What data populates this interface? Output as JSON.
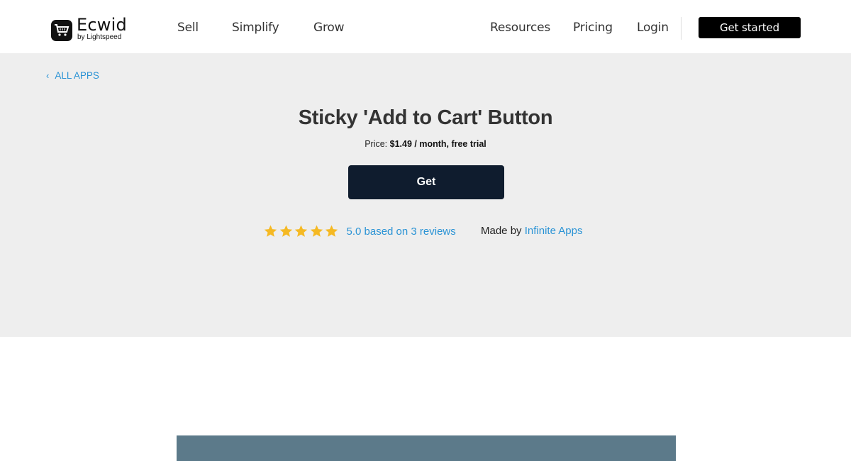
{
  "header": {
    "logo_name": "Ecwid",
    "logo_sub": "by Lightspeed",
    "nav": {
      "sell": "Sell",
      "simplify": "Simplify",
      "grow": "Grow",
      "resources": "Resources",
      "pricing": "Pricing",
      "login": "Login"
    },
    "cta_label": "Get started"
  },
  "hero": {
    "back_label": "ALL APPS",
    "title": "Sticky 'Add to Cart' Button",
    "price_prefix": "Price:",
    "price_value": "$1.49 / month, free trial",
    "get_label": "Get",
    "rating": {
      "stars": 5,
      "text": "5.0 based on 3 reviews"
    },
    "made_by_prefix": "Made by",
    "developer": "Infinite Apps"
  },
  "colors": {
    "accent_link": "#2a93d5",
    "hero_bg": "#eeeeee",
    "get_button_bg": "#0f1c2e",
    "star": "#f5b923",
    "preview_block": "#5c7a8a"
  }
}
